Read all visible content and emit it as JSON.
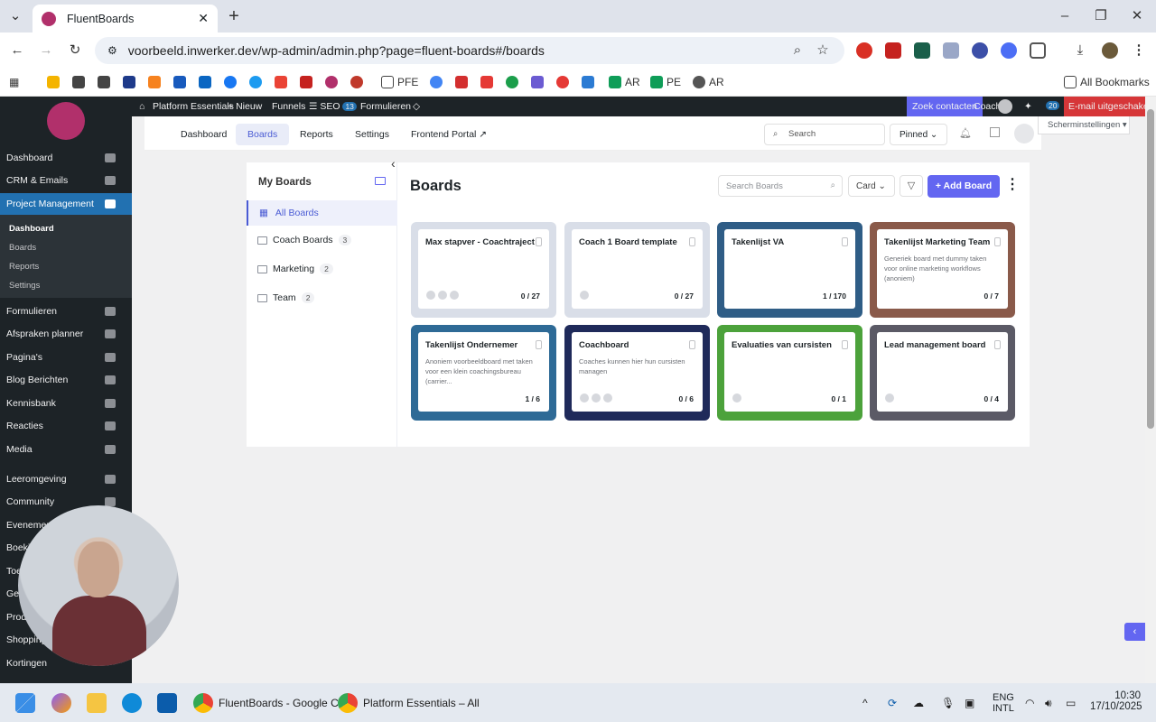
{
  "browser": {
    "tab_title": "FluentBoards",
    "url": "voorbeeld.inwerker.dev/wp-admin/admin.php?page=fluent-boards#/boards",
    "bookmarks": [
      "PFE",
      "AR",
      "PE",
      "AR"
    ],
    "all_bookmarks": "All Bookmarks"
  },
  "wpbar": {
    "site": "Platform Essentials",
    "new": "Nieuw",
    "funnels": "Funnels",
    "seo": "SEO",
    "seo_count": "13",
    "forms": "Formulieren",
    "contacts": "Zoek contacten",
    "user": "Coach",
    "notif_count": "20",
    "email_disabled": "E-mail uitgeschakeld"
  },
  "sidebar": {
    "items": [
      {
        "label": "Dashboard"
      },
      {
        "label": "CRM & Emails"
      },
      {
        "label": "Project Management"
      },
      {
        "label": "Formulieren"
      },
      {
        "label": "Afspraken planner"
      },
      {
        "label": "Pagina's"
      },
      {
        "label": "Blog Berichten"
      },
      {
        "label": "Kennisbank"
      },
      {
        "label": "Reacties"
      },
      {
        "label": "Media"
      },
      {
        "label": "Leeromgeving"
      },
      {
        "label": "Community"
      },
      {
        "label": "Evenementen"
      },
      {
        "label": "Boeki"
      },
      {
        "label": "Toe"
      },
      {
        "label": "Geb"
      },
      {
        "label": "Produ"
      },
      {
        "label": "Shopping"
      },
      {
        "label": "Kortingen"
      }
    ],
    "subitems": [
      "Dashboard",
      "Boards",
      "Reports",
      "Settings"
    ]
  },
  "topnav": {
    "tabs": [
      "Dashboard",
      "Boards",
      "Reports",
      "Settings",
      "Frontend Portal ↗"
    ],
    "search_placeholder": "Search",
    "pinned": "Pinned",
    "screen_options": "Scherminstellingen"
  },
  "my_boards": {
    "title": "My Boards",
    "items": [
      {
        "label": "All Boards",
        "count": ""
      },
      {
        "label": "Coach Boards",
        "count": "3"
      },
      {
        "label": "Marketing",
        "count": "2"
      },
      {
        "label": "Team",
        "count": "2"
      }
    ]
  },
  "boards": {
    "title": "Boards",
    "search_placeholder": "Search Boards",
    "view": "Card",
    "add_label": "+ Add Board",
    "cards": [
      {
        "title": "Max stapver - Coachtraject",
        "desc": "",
        "count": "0 / 27",
        "avatars": 3,
        "bg": "#d9dee8"
      },
      {
        "title": "Coach 1 Board template",
        "desc": "",
        "count": "0 / 27",
        "avatars": 1,
        "bg": "#d9dee8"
      },
      {
        "title": "Takenlijst VA",
        "desc": "",
        "count": "1 / 170",
        "avatars": 0,
        "bg": "#2f5d86"
      },
      {
        "title": "Takenlijst Marketing Team",
        "desc": "Generiek board met dummy taken voor online marketing workflows (anoniem)",
        "count": "0 / 7",
        "avatars": 0,
        "bg": "#8a5a4a"
      },
      {
        "title": "Takenlijst Ondernemer",
        "desc": "Anoniem voorbeeldboard met taken voor een klein coachingsbureau (carrier...",
        "count": "1 / 6",
        "avatars": 0,
        "bg": "#2e6a96"
      },
      {
        "title": "Coachboard",
        "desc": "Coaches kunnen hier hun cursisten managen",
        "count": "0 / 6",
        "avatars": 3,
        "bg": "#1f2a5a"
      },
      {
        "title": "Evaluaties van cursisten",
        "desc": "",
        "count": "0 / 1",
        "avatars": 1,
        "bg": "#4ca23b"
      },
      {
        "title": "Lead management board",
        "desc": "",
        "count": "0 / 4",
        "avatars": 1,
        "bg": "#5b5a66"
      }
    ]
  },
  "taskbar": {
    "apps": [
      "FluentBoards - Google C",
      "Platform Essentials – All"
    ],
    "lang": "ENG",
    "lang2": "INTL",
    "time": "10:30",
    "date": "17/10/2025"
  }
}
